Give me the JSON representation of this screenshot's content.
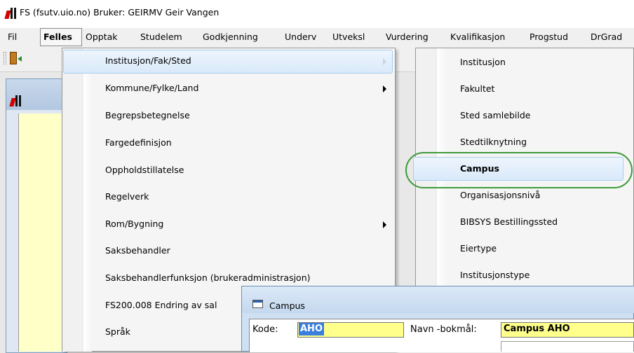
{
  "window": {
    "title": "FS (fsutv.uio.no) Bruker: GEIRMV Geir Vangen"
  },
  "menubar": {
    "items": [
      "Fil",
      "Felles",
      "Opptak",
      "Studelem",
      "Godkjenning",
      "Underv",
      "Utveksl",
      "Vurdering",
      "Kvalifikasjon",
      "Progstud",
      "DrGrad"
    ]
  },
  "felles_menu": {
    "items": [
      {
        "label": "Institusjon/Fak/Sted",
        "submenu": true
      },
      {
        "label": "Kommune/Fylke/Land",
        "submenu": true
      },
      {
        "label": "Begrepsbetegnelse",
        "submenu": false
      },
      {
        "label": "Fargedefinisjon",
        "submenu": false
      },
      {
        "label": "Oppholdstillatelse",
        "submenu": false
      },
      {
        "label": "Regelverk",
        "submenu": false
      },
      {
        "label": "Rom/Bygning",
        "submenu": true
      },
      {
        "label": "Saksbehandler",
        "submenu": false
      },
      {
        "label": "Saksbehandlerfunksjon (brukeradministrasjon)",
        "submenu": false
      },
      {
        "label": "FS200.008 Endring av sal",
        "submenu": false
      },
      {
        "label": "Språk",
        "submenu": false
      }
    ]
  },
  "submenu": {
    "items": [
      "Institusjon",
      "Fakultet",
      "Sted samlebilde",
      "Stedtilknytning",
      "Campus",
      "Organisasjonsnivå",
      "BIBSYS Bestillingssted",
      "Eiertype",
      "Institusjonstype"
    ]
  },
  "campus_window": {
    "title": "Campus",
    "kode_label": "Kode:",
    "kode_value": "AHO",
    "navn_label": "Navn -bokmål:",
    "navn_value": "Campus AHO"
  },
  "colors": {
    "highlight": "#d9e9fa",
    "field_yellow": "#ffff8c",
    "ring_green": "#3f9a3a"
  }
}
